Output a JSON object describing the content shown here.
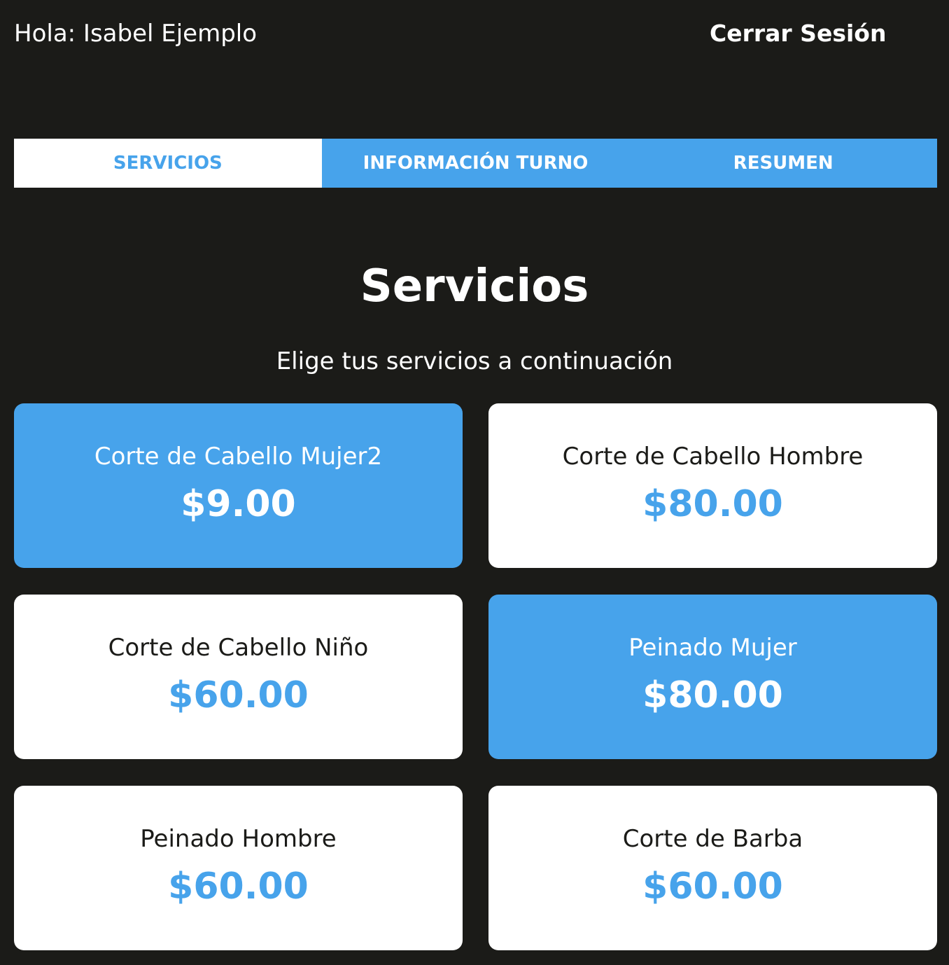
{
  "header": {
    "greeting": "Hola: Isabel Ejemplo",
    "logout_label": "Cerrar Sesión"
  },
  "tabs": [
    {
      "label": "SERVICIOS",
      "active": true
    },
    {
      "label": "INFORMACIÓN TURNO",
      "active": false
    },
    {
      "label": "RESUMEN",
      "active": false
    }
  ],
  "main": {
    "title": "Servicios",
    "subtitle": "Elige tus servicios a continuación"
  },
  "services": [
    {
      "name": "Corte de Cabello Mujer2",
      "price": "$9.00",
      "selected": true
    },
    {
      "name": "Corte de Cabello Hombre",
      "price": "$80.00",
      "selected": false
    },
    {
      "name": "Corte de Cabello Niño",
      "price": "$60.00",
      "selected": false
    },
    {
      "name": "Peinado Mujer",
      "price": "$80.00",
      "selected": true
    },
    {
      "name": "Peinado Hombre",
      "price": "$60.00",
      "selected": false
    },
    {
      "name": "Corte de Barba",
      "price": "$60.00",
      "selected": false
    }
  ],
  "colors": {
    "background": "#1b1b18",
    "accent": "#47a3eb",
    "card": "#ffffff"
  }
}
